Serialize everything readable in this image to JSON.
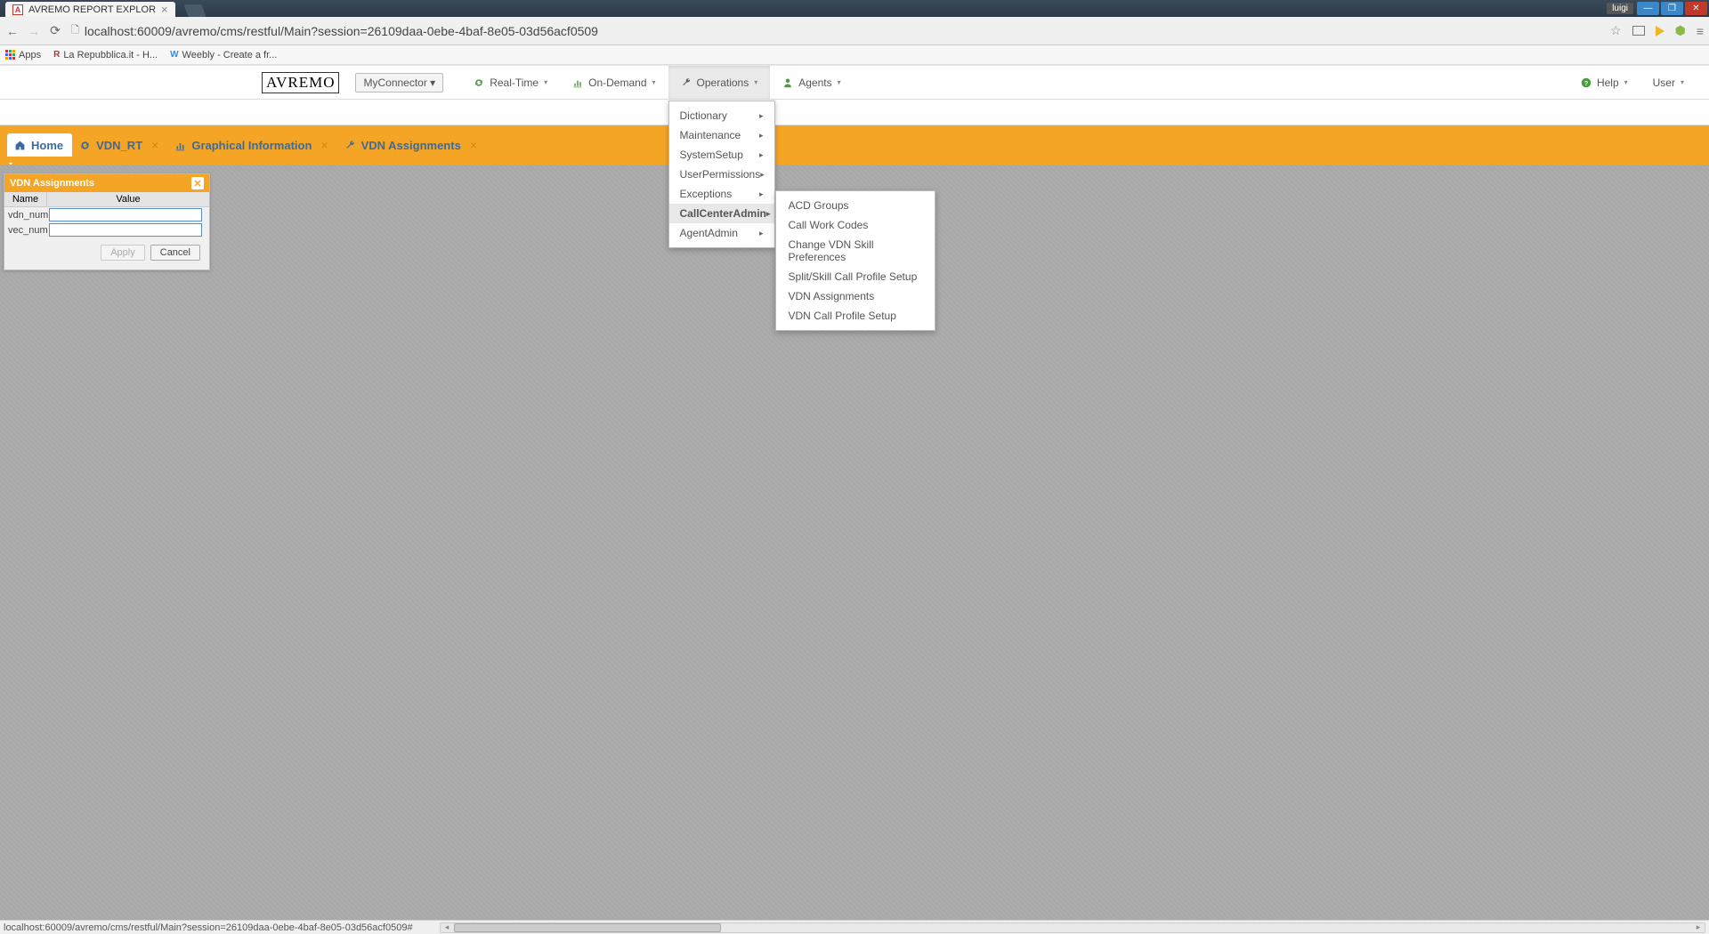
{
  "window": {
    "tab_title": "AVREMO REPORT EXPLOR",
    "tool_label": "luigi"
  },
  "browser": {
    "url": "localhost:60009/avremo/cms/restful/Main?session=26109daa-0ebe-4baf-8e05-03d56acf0509"
  },
  "bookmarks": {
    "apps": "Apps",
    "b1": "La Repubblica.it - H...",
    "b2": "Weebly - Create a fr..."
  },
  "nav": {
    "logo": "AVREMO",
    "connector": "MyConnector ▾",
    "realtime": "Real-Time",
    "ondemand": "On-Demand",
    "operations": "Operations",
    "agents": "Agents",
    "help": "Help",
    "user": "User"
  },
  "operations_menu": {
    "items": [
      "Dictionary",
      "Maintenance",
      "SystemSetup",
      "UserPermissions",
      "Exceptions",
      "CallCenterAdmin",
      "AgentAdmin"
    ],
    "hover_index": 5
  },
  "callcenter_submenu": {
    "items": [
      "ACD Groups",
      "Call Work Codes",
      "Change VDN Skill Preferences",
      "Split/Skill Call Profile Setup",
      "VDN Assignments",
      "VDN Call Profile Setup"
    ]
  },
  "tabs": {
    "t0": "Home",
    "t1": "VDN_RT",
    "t2": "Graphical Information",
    "t3": "VDN Assignments"
  },
  "panel": {
    "title": "VDN Assignments",
    "col_name": "Name",
    "col_value": "Value",
    "row1_label": "vdn_num",
    "row2_label": "vec_num",
    "apply": "Apply",
    "cancel": "Cancel"
  },
  "status": {
    "text": "localhost:60009/avremo/cms/restful/Main?session=26109daa-0ebe-4baf-8e05-03d56acf0509#"
  }
}
